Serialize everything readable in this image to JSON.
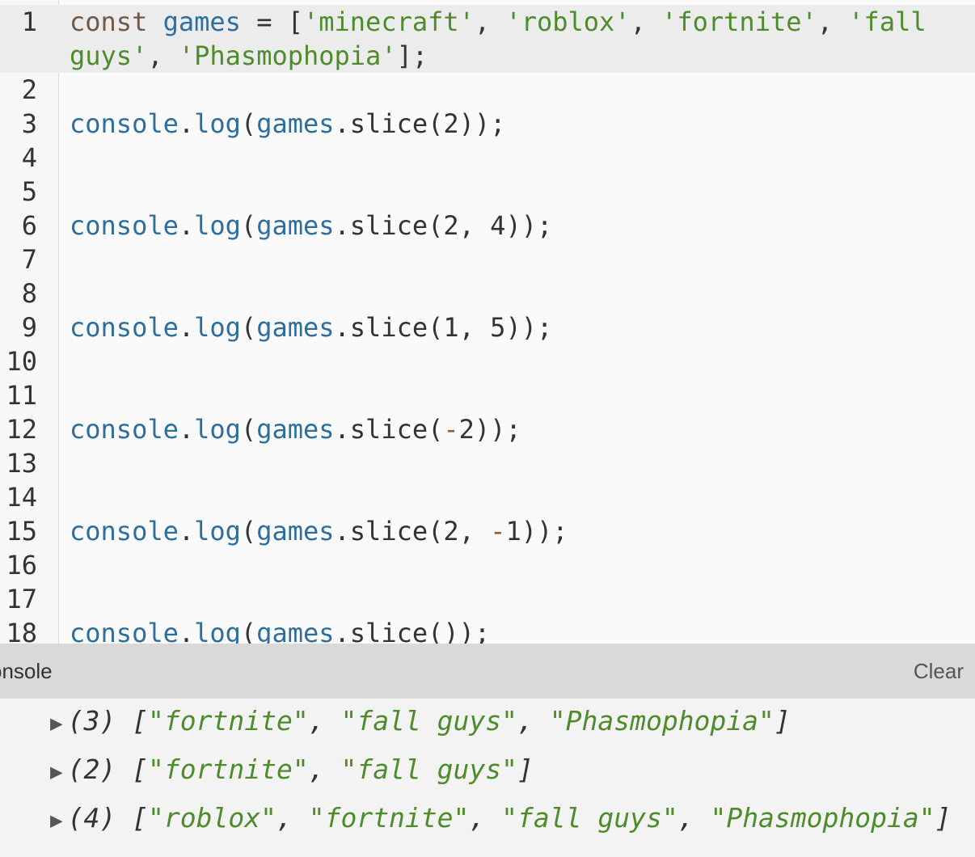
{
  "editor": {
    "line_numbers": [
      "1",
      "2",
      "3",
      "4",
      "5",
      "6",
      "7",
      "8",
      "9",
      "10",
      "11",
      "12",
      "13",
      "14",
      "15",
      "16",
      "17",
      "18"
    ],
    "lines": [
      {
        "num": "1",
        "tokens": [
          {
            "t": "const ",
            "c": "kw"
          },
          {
            "t": "games",
            "c": "var"
          },
          {
            "t": " = [",
            "c": "plain"
          },
          {
            "t": "'minecraft'",
            "c": "str"
          },
          {
            "t": ", ",
            "c": "plain"
          },
          {
            "t": "'roblox'",
            "c": "str"
          },
          {
            "t": ", ",
            "c": "plain"
          },
          {
            "t": "'fortnite'",
            "c": "str"
          },
          {
            "t": ", ",
            "c": "plain"
          },
          {
            "t": "'fall guys'",
            "c": "str"
          },
          {
            "t": ", ",
            "c": "plain"
          },
          {
            "t": "'Phasmophopia'",
            "c": "str"
          },
          {
            "t": "];",
            "c": "plain"
          }
        ]
      },
      {
        "num": "2",
        "tokens": []
      },
      {
        "num": "3",
        "tokens": [
          {
            "t": "console",
            "c": "var"
          },
          {
            "t": ".",
            "c": "plain"
          },
          {
            "t": "log",
            "c": "var"
          },
          {
            "t": "(",
            "c": "plain"
          },
          {
            "t": "games",
            "c": "var"
          },
          {
            "t": ".slice(2));",
            "c": "plain"
          }
        ]
      },
      {
        "num": "4",
        "tokens": []
      },
      {
        "num": "5",
        "tokens": []
      },
      {
        "num": "6",
        "tokens": [
          {
            "t": "console",
            "c": "var"
          },
          {
            "t": ".",
            "c": "plain"
          },
          {
            "t": "log",
            "c": "var"
          },
          {
            "t": "(",
            "c": "plain"
          },
          {
            "t": "games",
            "c": "var"
          },
          {
            "t": ".slice(2, 4));",
            "c": "plain"
          }
        ]
      },
      {
        "num": "7",
        "tokens": []
      },
      {
        "num": "8",
        "tokens": []
      },
      {
        "num": "9",
        "tokens": [
          {
            "t": "console",
            "c": "var"
          },
          {
            "t": ".",
            "c": "plain"
          },
          {
            "t": "log",
            "c": "var"
          },
          {
            "t": "(",
            "c": "plain"
          },
          {
            "t": "games",
            "c": "var"
          },
          {
            "t": ".slice(1, 5));",
            "c": "plain"
          }
        ]
      },
      {
        "num": "10",
        "tokens": []
      },
      {
        "num": "11",
        "tokens": []
      },
      {
        "num": "12",
        "tokens": [
          {
            "t": "console",
            "c": "var"
          },
          {
            "t": ".",
            "c": "plain"
          },
          {
            "t": "log",
            "c": "var"
          },
          {
            "t": "(",
            "c": "plain"
          },
          {
            "t": "games",
            "c": "var"
          },
          {
            "t": ".slice(",
            "c": "plain"
          },
          {
            "t": "-",
            "c": "op"
          },
          {
            "t": "2));",
            "c": "plain"
          }
        ]
      },
      {
        "num": "13",
        "tokens": []
      },
      {
        "num": "14",
        "tokens": []
      },
      {
        "num": "15",
        "tokens": [
          {
            "t": "console",
            "c": "var"
          },
          {
            "t": ".",
            "c": "plain"
          },
          {
            "t": "log",
            "c": "var"
          },
          {
            "t": "(",
            "c": "plain"
          },
          {
            "t": "games",
            "c": "var"
          },
          {
            "t": ".slice(2, ",
            "c": "plain"
          },
          {
            "t": "-",
            "c": "op"
          },
          {
            "t": "1));",
            "c": "plain"
          }
        ]
      },
      {
        "num": "16",
        "tokens": []
      },
      {
        "num": "17",
        "tokens": []
      },
      {
        "num": "18",
        "tokens": [
          {
            "t": "console",
            "c": "var"
          },
          {
            "t": ".",
            "c": "plain"
          },
          {
            "t": "log",
            "c": "var"
          },
          {
            "t": "(",
            "c": "plain"
          },
          {
            "t": "games",
            "c": "var"
          },
          {
            "t": ".slice());",
            "c": "plain"
          }
        ]
      }
    ]
  },
  "console": {
    "title": "onsole",
    "clear_label": "Clear",
    "expand_icon": "triangle-right-icon",
    "logs": [
      {
        "count": "(3)",
        "items": [
          "\"fortnite\"",
          "\"fall guys\"",
          "\"Phasmophopia\""
        ]
      },
      {
        "count": "(2)",
        "items": [
          "\"fortnite\"",
          "\"fall guys\""
        ]
      },
      {
        "count": "(4)",
        "items": [
          "\"roblox\"",
          "\"fortnite\"",
          "\"fall guys\"",
          "\"Phasmophopia\""
        ]
      }
    ]
  }
}
